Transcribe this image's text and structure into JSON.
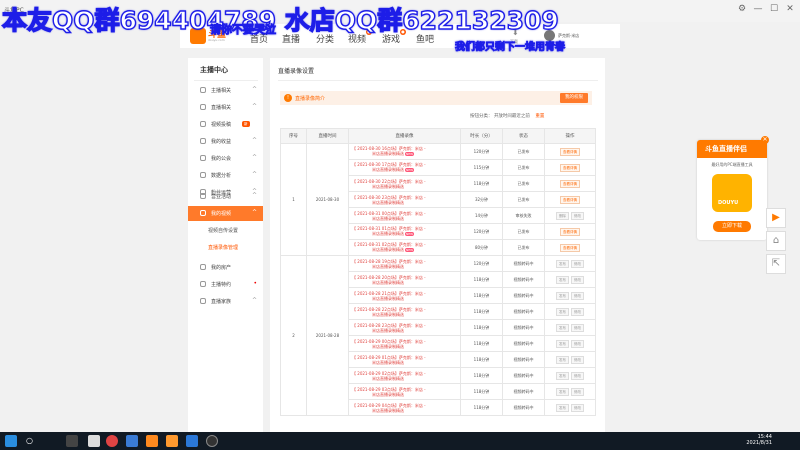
{
  "window": {
    "app_name": "斗鱼PC",
    "controls": [
      "⚙",
      "—",
      "☐",
      "✕"
    ]
  },
  "overlays": {
    "top_text": "本友QQ群694404789 水店QQ群622132309",
    "mid_text": "请你不要哭泣",
    "right_text": "我们都只剩下一堆用青春"
  },
  "site": {
    "logo": "斗鱼",
    "logo_sub": "douyu.com",
    "nav": [
      "首页",
      "直播",
      "分类",
      "视频",
      "游戏",
      "鱼吧"
    ],
    "download_label": "下载",
    "user_label": "萨克斯·米店"
  },
  "sidebar": {
    "title": "主播中心",
    "items": [
      {
        "label": "主播相关",
        "chev": "^"
      },
      {
        "label": "直播相关",
        "chev": "^"
      },
      {
        "label": "视频投稿",
        "badge": "新"
      },
      {
        "label": "我的收益",
        "chev": "^"
      },
      {
        "label": "我的公会",
        "chev": "^"
      },
      {
        "label": "数据分析",
        "chev": "^"
      },
      {
        "label": "粉丝运营",
        "chev": "^"
      },
      {
        "label": "营业活动",
        "chev": "^"
      },
      {
        "label": "我的视频",
        "chev": "^"
      }
    ],
    "subitems": [
      "视频自传设置",
      "直播录像管理"
    ],
    "items2": [
      {
        "label": "我的房产",
        "chev": ""
      },
      {
        "label": "主播特约",
        "chev": "•"
      },
      {
        "label": "直播家族",
        "chev": "^"
      }
    ]
  },
  "main": {
    "title": "直播录像设置",
    "notice_text": "直播录像简介",
    "notice_button": "我的权限",
    "sort_label": "按钮分类：",
    "sort_value": "开放时间最近之前",
    "reset_label": "重置",
    "columns": [
      "序号",
      "直播时间",
      "直播录像",
      "时长（分）",
      "状态",
      "操作"
    ],
    "groups": [
      {
        "index": "1",
        "date": "2021-08-30",
        "rows": [
          {
            "title": "【 2021-08-30 16点场】萨克斯：米店 -",
            "sub": "米店直播录制精选",
            "new": true,
            "duration": "120分钟",
            "status": "已发布",
            "ops": [
              "查看详情"
            ]
          },
          {
            "title": "【 2021-08-30 17点场】萨克斯：米店 -",
            "sub": "米店直播录制精选",
            "new": true,
            "duration": "115分钟",
            "status": "已发布",
            "ops": [
              "查看详情"
            ]
          },
          {
            "title": "【 2021-08-30 22点场】萨克斯：米店 -",
            "sub": "米店直播录制精选",
            "new": false,
            "duration": "118分钟",
            "status": "已发布",
            "ops": [
              "查看详情"
            ]
          },
          {
            "title": "【 2021-08-30 23点场】萨克斯：米店 -",
            "sub": "米店直播录制精选",
            "new": false,
            "duration": "32分钟",
            "status": "已发布",
            "ops": [
              "查看详情"
            ]
          },
          {
            "title": "【 2021-08-31 00点场】萨克斯：米店 -",
            "sub": "米店直播录制精选",
            "new": false,
            "duration": "14分钟",
            "status": "审核失败",
            "ops": [
              "删除",
              "修改"
            ]
          },
          {
            "title": "【 2021-08-31 01点场】萨克斯：米店 -",
            "sub": "米店直播录制精选",
            "new": true,
            "duration": "120分钟",
            "status": "已发布",
            "ops": [
              "查看详情"
            ]
          },
          {
            "title": "【 2021-08-31 02点场】萨克斯：米店 -",
            "sub": "米店直播录制精选",
            "new": true,
            "duration": "80分钟",
            "status": "已发布",
            "ops": [
              "查看详情"
            ]
          }
        ]
      },
      {
        "index": "2",
        "date": "2021-08-28",
        "rows": [
          {
            "title": "【 2021-08-28 19点场】萨克斯：米店 -",
            "sub": "米店直播录制精选",
            "new": false,
            "duration": "120分钟",
            "status": "视频转码中",
            "ops": [
              "发布",
              "修改"
            ]
          },
          {
            "title": "【 2021-08-28 20点场】萨克斯：米店 -",
            "sub": "米店直播录制精选",
            "new": false,
            "duration": "118分钟",
            "status": "视频转码中",
            "ops": [
              "发布",
              "修改"
            ]
          },
          {
            "title": "【 2021-08-28 21点场】萨克斯：米店 -",
            "sub": "米店直播录制精选",
            "new": false,
            "duration": "118分钟",
            "status": "视频转码中",
            "ops": [
              "发布",
              "修改"
            ]
          },
          {
            "title": "【 2021-08-28 22点场】萨克斯：米店 -",
            "sub": "米店直播录制精选",
            "new": false,
            "duration": "118分钟",
            "status": "视频转码中",
            "ops": [
              "发布",
              "修改"
            ]
          },
          {
            "title": "【 2021-08-28 23点场】萨克斯：米店 -",
            "sub": "米店直播录制精选",
            "new": false,
            "duration": "118分钟",
            "status": "视频转码中",
            "ops": [
              "发布",
              "修改"
            ]
          },
          {
            "title": "【 2021-08-29 00点场】萨克斯：米店 -",
            "sub": "米店直播录制精选",
            "new": false,
            "duration": "118分钟",
            "status": "视频转码中",
            "ops": [
              "发布",
              "修改"
            ]
          },
          {
            "title": "【 2021-08-29 01点场】萨克斯：米店 -",
            "sub": "米店直播录制精选",
            "new": false,
            "duration": "118分钟",
            "status": "视频转码中",
            "ops": [
              "发布",
              "修改"
            ]
          },
          {
            "title": "【 2021-08-29 02点场】萨克斯：米店 -",
            "sub": "米店直播录制精选",
            "new": false,
            "duration": "118分钟",
            "status": "视频转码中",
            "ops": [
              "发布",
              "修改"
            ]
          },
          {
            "title": "【 2021-08-29 03点场】萨克斯：米店 -",
            "sub": "米店直播录制精选",
            "new": false,
            "duration": "118分钟",
            "status": "视频转码中",
            "ops": [
              "发布",
              "修改"
            ]
          },
          {
            "title": "【 2021-08-29 04点场】萨克斯：米店 -",
            "sub": "米店直播录制精选",
            "new": false,
            "duration": "118分钟",
            "status": "视频转码中",
            "ops": [
              "发布",
              "修改"
            ]
          }
        ]
      }
    ]
  },
  "ad": {
    "title": "斗鱼直播伴侣",
    "desc": "最好用的PC端直播工具",
    "image_label": "DOUYU",
    "button": "立即下载",
    "close": "✕"
  },
  "right_tools": [
    "▶",
    "⌂",
    "⇱"
  ],
  "taskbar": {
    "time": "15:44",
    "date": "2021/8/31",
    "search_icon": "○"
  },
  "colors": {
    "accent": "#ff7a2a",
    "overlay_stroke": "#1d1de8"
  }
}
